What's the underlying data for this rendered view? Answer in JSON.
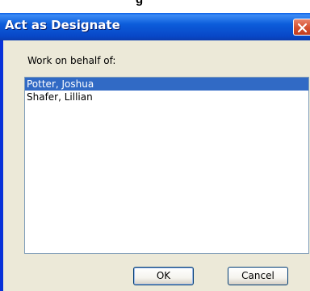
{
  "top_strip": {
    "text": "g"
  },
  "window": {
    "title": "Act as Designate",
    "close_icon": "close-icon"
  },
  "dialog": {
    "prompt": "Work on behalf of:",
    "list": {
      "items": [
        {
          "label": "Potter, Joshua",
          "selected": true
        },
        {
          "label": "Shafer, Lillian",
          "selected": false
        }
      ]
    },
    "ok_label": "OK",
    "cancel_label": "Cancel"
  },
  "colors": {
    "titlebar": "#0c5ddb",
    "dialog_bg": "#ece9d8",
    "selection": "#316ac5",
    "close_button": "#d4502f"
  }
}
